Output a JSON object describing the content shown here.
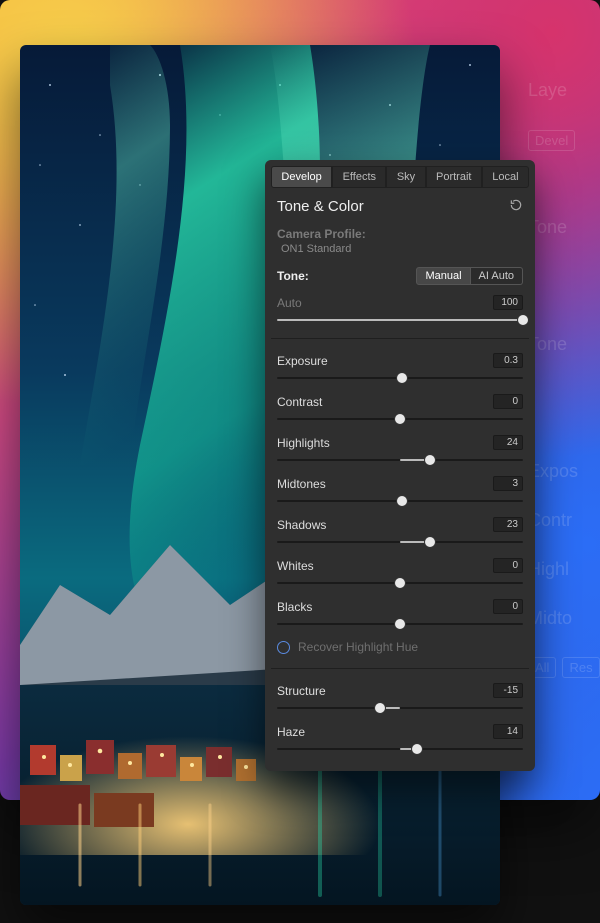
{
  "ghost": {
    "layer": "Laye",
    "develop": "Devel",
    "tone": "Tone",
    "toneLabel": "Tone",
    "exposure": "Expos",
    "contrast": "Contr",
    "highlights": "Highl",
    "midtones": "Midto",
    "reset": "Res",
    "all": "All"
  },
  "tabs": [
    {
      "label": "Develop",
      "active": true
    },
    {
      "label": "Effects",
      "active": false
    },
    {
      "label": "Sky",
      "active": false
    },
    {
      "label": "Portrait",
      "active": false
    },
    {
      "label": "Local",
      "active": false
    }
  ],
  "panel": {
    "title": "Tone & Color",
    "cameraProfileLabel": "Camera Profile:",
    "cameraProfileValue": "ON1 Standard",
    "toneLabel": "Tone:",
    "segments": [
      {
        "label": "Manual",
        "active": true
      },
      {
        "label": "AI Auto",
        "active": false
      }
    ],
    "checkboxLabel": "Recover Highlight Hue"
  },
  "sliders": {
    "auto": {
      "label": "Auto",
      "value": "100",
      "pos": 100,
      "fillFrom": 0,
      "muted": true
    },
    "exposure": {
      "label": "Exposure",
      "value": "0.3",
      "pos": 51,
      "fillFrom": 50,
      "muted": false
    },
    "contrast": {
      "label": "Contrast",
      "value": "0",
      "pos": 50,
      "fillFrom": 50,
      "muted": false
    },
    "highlights": {
      "label": "Highlights",
      "value": "24",
      "pos": 62,
      "fillFrom": 50,
      "muted": false
    },
    "midtones": {
      "label": "Midtones",
      "value": "3",
      "pos": 51,
      "fillFrom": 50,
      "muted": false
    },
    "shadows": {
      "label": "Shadows",
      "value": "23",
      "pos": 62,
      "fillFrom": 50,
      "muted": false
    },
    "whites": {
      "label": "Whites",
      "value": "0",
      "pos": 50,
      "fillFrom": 50,
      "muted": false
    },
    "blacks": {
      "label": "Blacks",
      "value": "0",
      "pos": 50,
      "fillFrom": 50,
      "muted": false
    },
    "structure": {
      "label": "Structure",
      "value": "-15",
      "pos": 42,
      "fillFrom": 50,
      "muted": false
    },
    "haze": {
      "label": "Haze",
      "value": "14",
      "pos": 57,
      "fillFrom": 50,
      "muted": false
    }
  }
}
